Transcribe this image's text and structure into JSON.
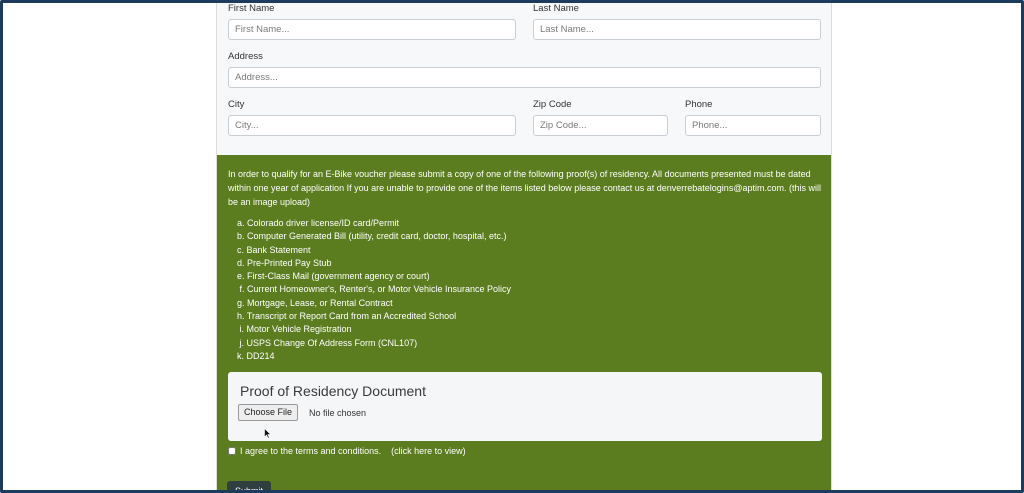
{
  "form": {
    "first_name": {
      "label": "First Name",
      "placeholder": "First Name..."
    },
    "last_name": {
      "label": "Last Name",
      "placeholder": "Last Name..."
    },
    "address": {
      "label": "Address",
      "placeholder": "Address..."
    },
    "city": {
      "label": "City",
      "placeholder": "City..."
    },
    "zip": {
      "label": "Zip Code",
      "placeholder": "Zip Code..."
    },
    "phone": {
      "label": "Phone",
      "placeholder": "Phone..."
    }
  },
  "residency": {
    "intro": "In order to qualify for an E-Bike voucher please submit a copy of one of the following proof(s) of residency. All documents presented must be dated within one year of application If you are unable to provide one of the items listed below please contact us at denverrebatelogins@aptim.com. (this will be an image upload)",
    "documents": [
      "a. Colorado driver license/ID card/Permit",
      "b. Computer Generated Bill (utility, credit card, doctor, hospital, etc.)",
      "c. Bank Statement",
      "d. Pre-Printed Pay Stub",
      "e. First-Class Mail (government agency or court)",
      " f. Current Homeowner's, Renter's, or Motor Vehicle Insurance Policy",
      "g. Mortgage, Lease, or Rental Contract",
      "h. Transcript or Report Card from an Accredited School",
      " i. Motor Vehicle Registration",
      " j. USPS Change Of Address Form (CNL107)",
      "k. DD214"
    ],
    "upload": {
      "title": "Proof of Residency Document",
      "button": "Choose File",
      "status": "No file chosen"
    },
    "terms": {
      "label": "I agree to the terms and conditions.",
      "link": "(click here to view)"
    },
    "submit": "Submit"
  },
  "colors": {
    "green_panel": "#5b7d1f",
    "frame_border": "#1d3b5c"
  }
}
